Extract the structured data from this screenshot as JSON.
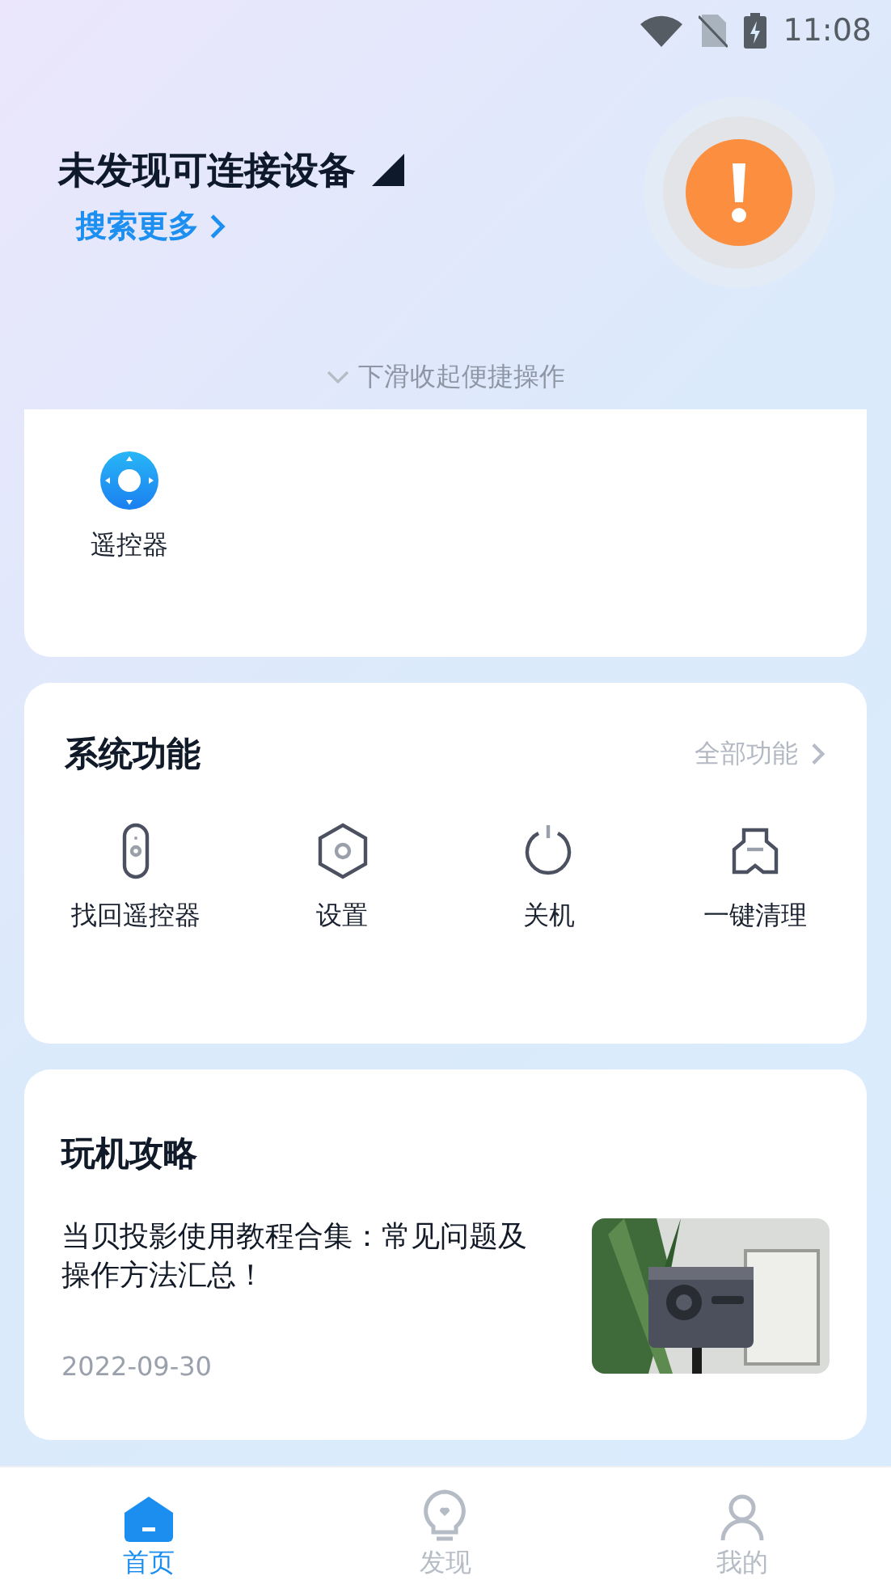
{
  "status_bar": {
    "time": "11:08"
  },
  "header": {
    "title": "未发现可连接设备",
    "link": "搜索更多",
    "hint": "下滑收起便捷操作"
  },
  "shortcuts": [
    {
      "label": "遥控器"
    }
  ],
  "system": {
    "title": "系统功能",
    "more": "全部功能",
    "items": [
      {
        "kind": "remote",
        "label": "找回遥控器"
      },
      {
        "kind": "settings",
        "label": "设置"
      },
      {
        "kind": "power",
        "label": "关机"
      },
      {
        "kind": "clean",
        "label": "一键清理"
      }
    ]
  },
  "guide": {
    "title": "玩机攻略",
    "articles": [
      {
        "title": "当贝投影使用教程合集：常见问题及操作方法汇总！",
        "date": "2022-09-30"
      }
    ]
  },
  "tab_bar": [
    {
      "kind": "home",
      "label": "首页",
      "selected": true
    },
    {
      "kind": "discover",
      "label": "发现",
      "selected": false
    },
    {
      "kind": "mine",
      "label": "我的",
      "selected": false
    }
  ]
}
